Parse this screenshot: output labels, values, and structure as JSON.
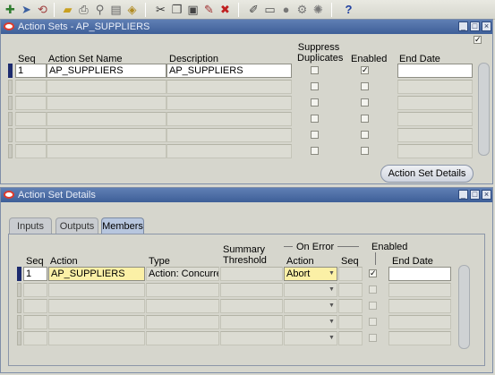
{
  "toolbar": {
    "icons": [
      "new-icon",
      "go-icon",
      "back-icon",
      "folder-icon",
      "print-icon",
      "attachment-icon",
      "navigator-icon",
      "zoom-icon",
      "cut-icon",
      "copy-icon",
      "paste-icon",
      "edit-icon",
      "clear-icon",
      "translate-icon",
      "window-icon",
      "globe-icon",
      "tools-icon",
      "flashlight-icon",
      "help-icon"
    ]
  },
  "action_sets_window": {
    "title": "Action Sets - AP_SUPPLIERS",
    "columns": {
      "seq": "Seq",
      "name": "Action Set Name",
      "description": "Description",
      "suppress_duplicates": "Suppress\nDuplicates",
      "enabled": "Enabled",
      "end_date": "End Date"
    },
    "rows": [
      {
        "seq": "1",
        "name": "AP_SUPPLIERS",
        "description": "AP_SUPPLIERS",
        "suppress_duplicates": false,
        "enabled": true,
        "end_date": ""
      },
      {
        "seq": "",
        "name": "",
        "description": "",
        "suppress_duplicates": false,
        "enabled": false,
        "end_date": ""
      },
      {
        "seq": "",
        "name": "",
        "description": "",
        "suppress_duplicates": false,
        "enabled": false,
        "end_date": ""
      },
      {
        "seq": "",
        "name": "",
        "description": "",
        "suppress_duplicates": false,
        "enabled": false,
        "end_date": ""
      },
      {
        "seq": "",
        "name": "",
        "description": "",
        "suppress_duplicates": false,
        "enabled": false,
        "end_date": ""
      },
      {
        "seq": "",
        "name": "",
        "description": "",
        "suppress_duplicates": false,
        "enabled": false,
        "end_date": ""
      }
    ],
    "details_button": "Action Set Details"
  },
  "action_set_details_window": {
    "title": "Action Set Details",
    "tabs": [
      "Inputs",
      "Outputs",
      "Members"
    ],
    "active_tab": "Members",
    "columns": {
      "seq": "Seq",
      "action": "Action",
      "type": "Type",
      "summary_threshold": "Summary\nThreshold",
      "on_error": "On Error",
      "on_error_action": "Action",
      "on_error_seq": "Seq",
      "enabled": "Enabled",
      "end_date": "End Date"
    },
    "rows": [
      {
        "seq": "1",
        "action": "AP_SUPPLIERS",
        "type": "Action: Concurrent",
        "summary_threshold": "",
        "on_error_action": "Abort",
        "on_error_seq": "",
        "enabled": true,
        "end_date": ""
      },
      {
        "seq": "",
        "action": "",
        "type": "",
        "summary_threshold": "",
        "on_error_action": "",
        "on_error_seq": "",
        "enabled": false,
        "end_date": ""
      },
      {
        "seq": "",
        "action": "",
        "type": "",
        "summary_threshold": "",
        "on_error_action": "",
        "on_error_seq": "",
        "enabled": false,
        "end_date": ""
      },
      {
        "seq": "",
        "action": "",
        "type": "",
        "summary_threshold": "",
        "on_error_action": "",
        "on_error_seq": "",
        "enabled": false,
        "end_date": ""
      },
      {
        "seq": "",
        "action": "",
        "type": "",
        "summary_threshold": "",
        "on_error_action": "",
        "on_error_seq": "",
        "enabled": false,
        "end_date": ""
      }
    ]
  }
}
